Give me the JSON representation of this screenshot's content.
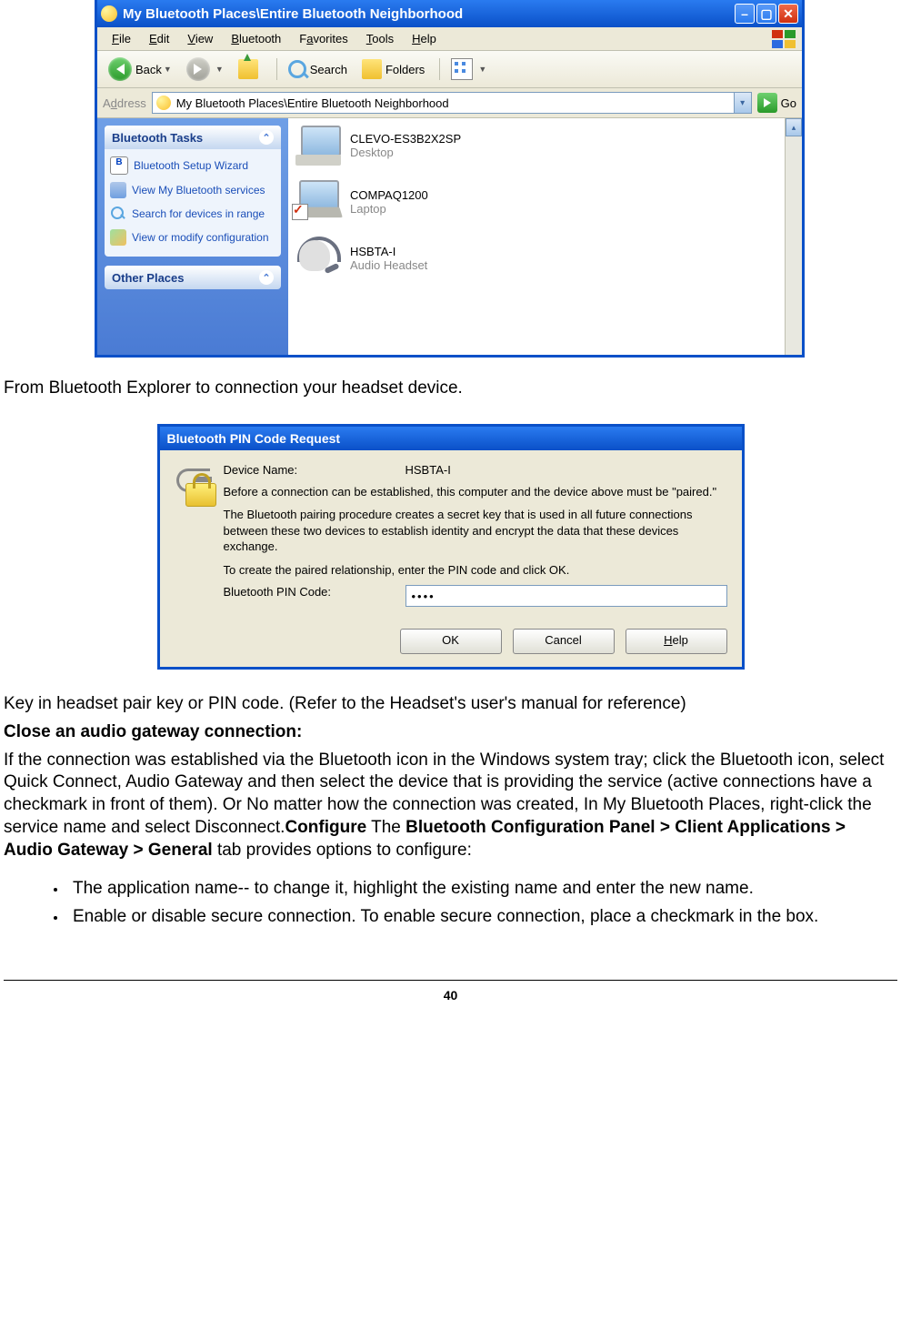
{
  "win1": {
    "title": "My Bluetooth Places\\Entire Bluetooth Neighborhood",
    "menu": {
      "file": "File",
      "f_u": "F",
      "edit": "Edit",
      "e_u": "E",
      "view": "View",
      "v_u": "V",
      "bluetooth": "Bluetooth",
      "b_u": "B",
      "favorites": "Favorites",
      "fa_u": "a",
      "tools": "Tools",
      "t_u": "T",
      "help": "Help",
      "h_u": "H"
    },
    "toolbar": {
      "back": "Back",
      "search": "Search",
      "folders": "Folders"
    },
    "address": {
      "label": "Address",
      "value": "My Bluetooth Places\\Entire Bluetooth Neighborhood",
      "go": "Go"
    },
    "sidebar": {
      "tasks_title": "Bluetooth Tasks",
      "other_title": "Other Places",
      "tasks": [
        "Bluetooth Setup Wizard",
        "View My Bluetooth services",
        "Search for devices in range",
        "View or modify configuration"
      ]
    },
    "devices": [
      {
        "name": "CLEVO-ES3B2X2SP",
        "type": "Desktop"
      },
      {
        "name": "COMPAQ1200",
        "type": "Laptop"
      },
      {
        "name": "HSBTA-I",
        "type": "Audio Headset"
      }
    ]
  },
  "doc": {
    "p1": "From Bluetooth Explorer to connection your headset device.",
    "p2": "Key in headset pair key or PIN code. (Refer to the Headset's user's manual for reference)",
    "h1": "Close an audio gateway connection:",
    "p3a": "If the connection was established via the Bluetooth icon in the Windows system tray; click the Bluetooth icon, select Quick Connect, Audio Gateway and then select the device that is providing the service (active connections have a checkmark in front of them). Or No matter how the connection was created, In My Bluetooth Places, right-click the service name and select Disconnect.",
    "cfg": "Configure",
    "p3b": " The ",
    "cfgpath": "Bluetooth Configuration Panel > Client Applications > Audio Gateway > General",
    "p3c": " tab provides options to configure:",
    "li1": "The application name-- to change it, highlight the existing name and enter the new name.",
    "li2": "Enable or disable secure connection. To enable secure connection, place a checkmark in the box.",
    "pagenum": "40"
  },
  "dlg": {
    "title": "Bluetooth PIN Code Request",
    "devname_lbl": "Device Name:",
    "devname_val": "HSBTA-I",
    "para1": "Before a connection can be established, this computer and the device above must be \"paired.\"",
    "para2": "The Bluetooth pairing procedure creates a secret key that is used in all future connections between these two devices to establish identity and encrypt the data that these devices exchange.",
    "para3": "To create the paired relationship, enter the PIN code and click OK.",
    "pin_lbl": "Bluetooth PIN Code:",
    "pin_val": "••••",
    "ok": "OK",
    "cancel": "Cancel",
    "help": "Help",
    "help_u": "H"
  }
}
